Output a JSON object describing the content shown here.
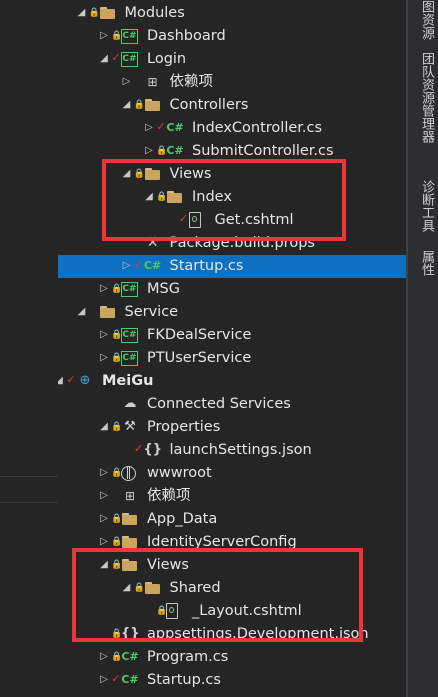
{
  "tree": [
    {
      "label": "Modules",
      "arrow": "◢",
      "lock": true,
      "check": false,
      "icon": "folder",
      "icon_name": "folder-icon"
    },
    {
      "label": "Dashboard",
      "arrow": "▷",
      "lock": true,
      "check": false,
      "icon": "cs",
      "icon_name": "csharp-project-icon"
    },
    {
      "label": "Login",
      "arrow": "◢",
      "lock": false,
      "check": true,
      "icon": "cs",
      "icon_name": "csharp-project-icon"
    },
    {
      "label": "依赖项",
      "arrow": "▷",
      "lock": false,
      "check": false,
      "icon": "deps",
      "icon_name": "dependencies-icon"
    },
    {
      "label": "Controllers",
      "arrow": "◢",
      "lock": true,
      "check": false,
      "icon": "folder",
      "icon_name": "folder-icon"
    },
    {
      "label": "IndexController.cs",
      "arrow": "▷",
      "lock": false,
      "check": true,
      "icon": "csplain",
      "icon_name": "csharp-file-icon"
    },
    {
      "label": "SubmitController.cs",
      "arrow": "▷",
      "lock": true,
      "check": false,
      "icon": "csplain",
      "icon_name": "csharp-file-icon"
    },
    {
      "label": "Views",
      "arrow": "◢",
      "lock": true,
      "check": false,
      "icon": "folder",
      "icon_name": "folder-icon"
    },
    {
      "label": "Index",
      "arrow": "◢",
      "lock": true,
      "check": false,
      "icon": "folder",
      "icon_name": "folder-icon"
    },
    {
      "label": "Get.cshtml",
      "arrow": "",
      "lock": false,
      "check": true,
      "icon": "file",
      "icon_name": "cshtml-file-icon"
    },
    {
      "label": "Package.build.props",
      "arrow": "",
      "lock": false,
      "check": false,
      "icon": "wrench",
      "icon_name": "props-file-icon"
    },
    {
      "label": "Startup.cs",
      "arrow": "▷",
      "lock": false,
      "check": true,
      "icon": "csplain",
      "icon_name": "csharp-file-icon",
      "selected": true
    },
    {
      "label": "MSG",
      "arrow": "▷",
      "lock": true,
      "check": false,
      "icon": "cs",
      "icon_name": "csharp-project-icon"
    },
    {
      "label": "Service",
      "arrow": "◢",
      "lock": false,
      "check": false,
      "icon": "folder",
      "icon_name": "folder-icon"
    },
    {
      "label": "FKDealService",
      "arrow": "▷",
      "lock": true,
      "check": false,
      "icon": "cs",
      "icon_name": "csharp-project-icon"
    },
    {
      "label": "PTUserService",
      "arrow": "▷",
      "lock": true,
      "check": false,
      "icon": "cs",
      "icon_name": "csharp-project-icon"
    },
    {
      "label": "MeiGu",
      "arrow": "◢",
      "lock": false,
      "check": true,
      "icon": "globe",
      "icon_name": "web-project-icon",
      "bold": true
    },
    {
      "label": "Connected Services",
      "arrow": "",
      "lock": false,
      "check": false,
      "icon": "cloud",
      "icon_name": "cloud-icon"
    },
    {
      "label": "Properties",
      "arrow": "◢",
      "lock": true,
      "check": false,
      "icon": "wrench",
      "icon_name": "wrench-icon"
    },
    {
      "label": "launchSettings.json",
      "arrow": "",
      "lock": false,
      "check": true,
      "icon": "json",
      "icon_name": "json-file-icon"
    },
    {
      "label": "wwwroot",
      "arrow": "▷",
      "lock": true,
      "check": false,
      "icon": "web",
      "icon_name": "globe-icon"
    },
    {
      "label": "依赖项",
      "arrow": "▷",
      "lock": false,
      "check": false,
      "icon": "deps",
      "icon_name": "dependencies-icon"
    },
    {
      "label": "App_Data",
      "arrow": "▷",
      "lock": true,
      "check": false,
      "icon": "folder",
      "icon_name": "folder-icon"
    },
    {
      "label": "IdentityServerConfig",
      "arrow": "▷",
      "lock": true,
      "check": false,
      "icon": "folder",
      "icon_name": "folder-icon"
    },
    {
      "label": "Views",
      "arrow": "◢",
      "lock": true,
      "check": false,
      "icon": "folder",
      "icon_name": "folder-icon"
    },
    {
      "label": "Shared",
      "arrow": "◢",
      "lock": true,
      "check": false,
      "icon": "folder",
      "icon_name": "folder-icon"
    },
    {
      "label": "_Layout.cshtml",
      "arrow": "",
      "lock": true,
      "check": false,
      "icon": "file",
      "icon_name": "cshtml-file-icon"
    },
    {
      "label": "appsettings.Development.json",
      "arrow": "",
      "lock": true,
      "check": false,
      "icon": "json",
      "icon_name": "json-file-icon"
    },
    {
      "label": "Program.cs",
      "arrow": "▷",
      "lock": true,
      "check": false,
      "icon": "csplain",
      "icon_name": "csharp-file-icon"
    },
    {
      "label": "Startup.cs",
      "arrow": "▷",
      "lock": false,
      "check": true,
      "icon": "csplain",
      "icon_name": "csharp-file-icon"
    }
  ],
  "right_tabs": [
    "图资源管理器",
    "团队资源管理器",
    "诊断工具",
    "属性"
  ],
  "colors": {
    "selection": "#0e70c0",
    "highlight": "#f0343b",
    "lock": "#3d9be9",
    "check": "#e0393e",
    "csharp": "#4ec96b"
  }
}
